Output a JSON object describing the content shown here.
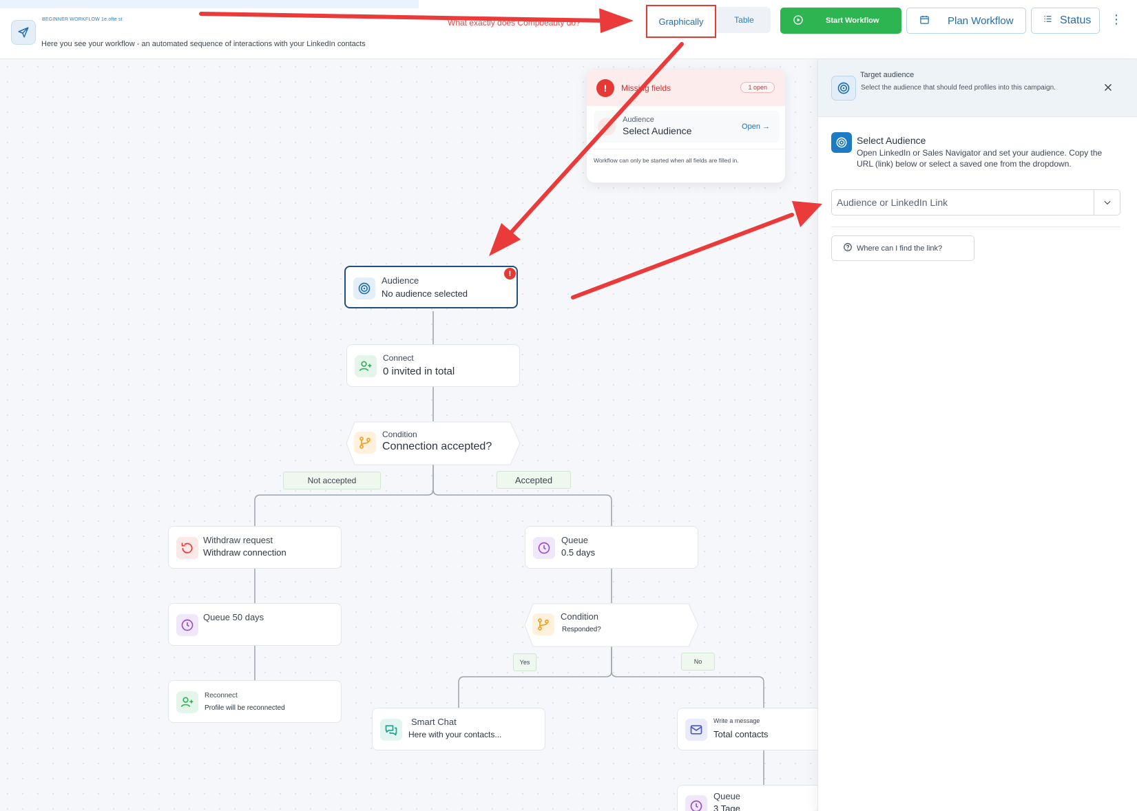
{
  "header": {
    "workflow_title": "BEGINNER WORKFLOW 1e.ofte st",
    "description": "Here you see your workflow - an automated sequence of interactions with your LinkedIn contacts",
    "question": "What exactly does Compbeauty do?",
    "tabs": {
      "graphically": "Graphically",
      "table": "Table"
    },
    "buttons": {
      "start": "Start Workflow",
      "plan": "Plan Workflow",
      "status": "Status"
    }
  },
  "missing_fields": {
    "title": "Missing fields",
    "badge": "1 open",
    "item_label": "Audience",
    "item_value": "Select Audience",
    "open_link": "Open →",
    "note": "Workflow can only be started when all fields are filled in."
  },
  "panel": {
    "title": "Target audience",
    "subtitle": "Select the audience that should feed profiles into this campaign.",
    "select_title": "Select Audience",
    "select_desc": "Open LinkedIn or Sales Navigator and set your audience. Copy the URL (link) below or select a saved one from the dropdown.",
    "input_placeholder": "Audience or LinkedIn Link",
    "help_button": "Where can I find the link?"
  },
  "nodes": {
    "audience": {
      "label": "Audience",
      "sub": "No audience selected"
    },
    "connect": {
      "label": "Connect",
      "sub": "0 invited in total"
    },
    "condition1": {
      "label": "Condition",
      "sub": "Connection accepted?"
    },
    "withdraw": {
      "label": "Withdraw request",
      "sub": "Withdraw connection"
    },
    "queue_a": {
      "label": "Queue",
      "sub": "0.5 days"
    },
    "queue50": {
      "label": "Queue 50 days"
    },
    "condition2": {
      "label": "Condition",
      "sub": "Responded?"
    },
    "reconnect": {
      "label": "Reconnect",
      "sub": "Profile will be reconnected"
    },
    "smartchat": {
      "label": "Smart Chat",
      "sub": "Here with your contacts..."
    },
    "message": {
      "label": "Write a message",
      "sub": "Total contacts"
    },
    "queue_b": {
      "label": "Queue",
      "sub": "3 Tage"
    }
  },
  "branches": {
    "not_accepted": "Not accepted",
    "accepted": "Accepted",
    "yes": "Yes",
    "no": "No"
  },
  "colors": {
    "primary": "#1f6fb0",
    "start_green": "#2db552",
    "error_red": "#e53935"
  }
}
